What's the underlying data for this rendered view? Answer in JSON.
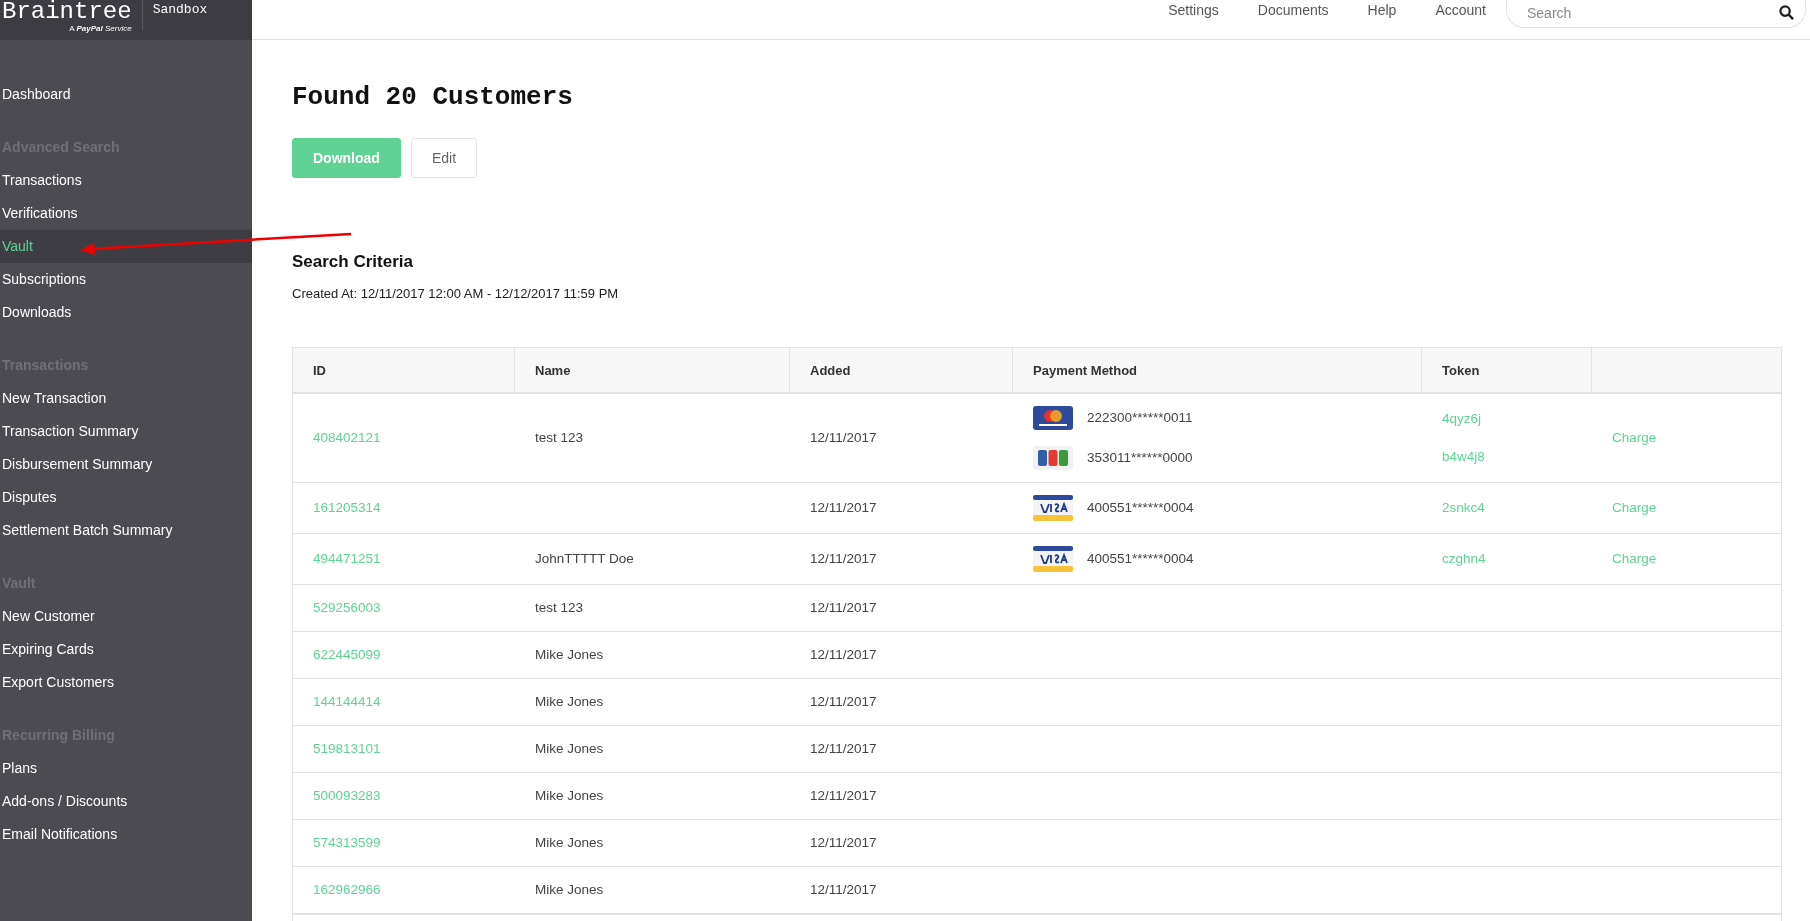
{
  "brand": {
    "name": "Braintree",
    "tagline_prefix": "A",
    "tagline_brand": "PayPal",
    "tagline_suffix": "Service",
    "environment": "Sandbox"
  },
  "top_nav": {
    "links": [
      "Settings",
      "Documents",
      "Help",
      "Account"
    ],
    "search": {
      "placeholder": "Search"
    }
  },
  "sidebar": {
    "items": [
      {
        "kind": "link",
        "label": "Dashboard",
        "selected": false
      },
      {
        "kind": "heading",
        "label": "Advanced Search"
      },
      {
        "kind": "link",
        "label": "Transactions",
        "selected": false
      },
      {
        "kind": "link",
        "label": "Verifications",
        "selected": false
      },
      {
        "kind": "link",
        "label": "Vault",
        "selected": true
      },
      {
        "kind": "link",
        "label": "Subscriptions",
        "selected": false
      },
      {
        "kind": "link",
        "label": "Downloads",
        "selected": false
      },
      {
        "kind": "heading",
        "label": "Transactions"
      },
      {
        "kind": "link",
        "label": "New Transaction",
        "selected": false
      },
      {
        "kind": "link",
        "label": "Transaction Summary",
        "selected": false
      },
      {
        "kind": "link",
        "label": "Disbursement Summary",
        "selected": false
      },
      {
        "kind": "link",
        "label": "Disputes",
        "selected": false
      },
      {
        "kind": "link",
        "label": "Settlement Batch Summary",
        "selected": false
      },
      {
        "kind": "heading",
        "label": "Vault"
      },
      {
        "kind": "link",
        "label": "New Customer",
        "selected": false
      },
      {
        "kind": "link",
        "label": "Expiring Cards",
        "selected": false
      },
      {
        "kind": "link",
        "label": "Export Customers",
        "selected": false
      },
      {
        "kind": "heading",
        "label": "Recurring Billing"
      },
      {
        "kind": "link",
        "label": "Plans",
        "selected": false
      },
      {
        "kind": "link",
        "label": "Add-ons / Discounts",
        "selected": false
      },
      {
        "kind": "link",
        "label": "Email Notifications",
        "selected": false
      }
    ]
  },
  "title": "Found 20 Customers",
  "actions": [
    {
      "kind": "primary",
      "label": "Download"
    },
    {
      "kind": "secondary",
      "label": "Edit"
    }
  ],
  "search_criteria": {
    "heading": "Search Criteria",
    "text": "Created At: 12/11/2017 12:00 AM - 12/12/2017 11:59 PM"
  },
  "table": {
    "columns": [
      "ID",
      "Name",
      "Added",
      "Payment Method",
      "Token"
    ],
    "rows": [
      {
        "id": "408402121",
        "name": "test 123",
        "added": "12/11/2017",
        "methods": [
          {
            "kind": "mastercard",
            "number": "222300******0011",
            "token": "4qyz6j"
          },
          {
            "kind": "jcb",
            "number": "353011******0000",
            "token": "b4w4j8"
          }
        ],
        "action": "Charge"
      },
      {
        "id": "161205314",
        "name": "",
        "added": "12/11/2017",
        "methods": [
          {
            "kind": "visa",
            "number": "400551******0004",
            "token": "2snkc4"
          }
        ],
        "action": "Charge"
      },
      {
        "id": "494471251",
        "name": "JohnTTTTT Doe",
        "added": "12/11/2017",
        "methods": [
          {
            "kind": "visa",
            "number": "400551******0004",
            "token": "czghn4"
          }
        ],
        "action": "Charge"
      },
      {
        "id": "529256003",
        "name": "test 123",
        "added": "12/11/2017"
      },
      {
        "id": "622445099",
        "name": "Mike Jones",
        "added": "12/11/2017"
      },
      {
        "id": "144144414",
        "name": "Mike Jones",
        "added": "12/11/2017"
      },
      {
        "id": "519813101",
        "name": "Mike Jones",
        "added": "12/11/2017"
      },
      {
        "id": "500093283",
        "name": "Mike Jones",
        "added": "12/11/2017"
      },
      {
        "id": "574313599",
        "name": "Mike Jones",
        "added": "12/11/2017"
      },
      {
        "id": "162962966",
        "name": "Mike Jones",
        "added": "12/11/2017"
      }
    ]
  }
}
